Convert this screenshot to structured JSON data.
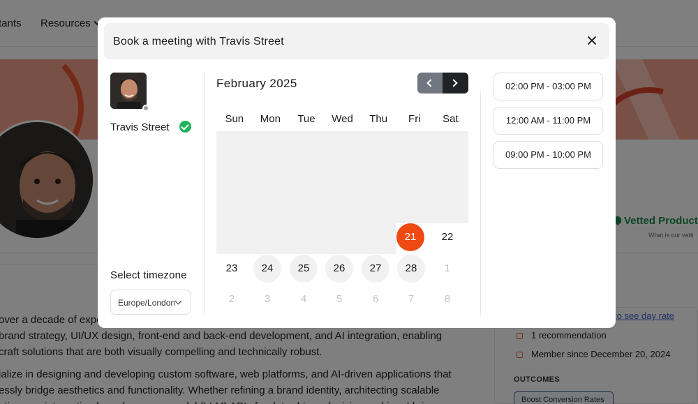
{
  "background": {
    "nav": {
      "consultants": "tants",
      "resources": "Resources"
    },
    "vetted_label": "Vetted Product",
    "vetting_note": "What is our vetti",
    "paragraph1": [
      "over a decade of expe",
      " brand strategy, UI/UX design, front-end and back-end development, and AI integration, enabling",
      " craft solutions that are both visually compelling and technically robust."
    ],
    "paragraph2": [
      "ialize in designing and developing custom software, web platforms, and AI-driven applications that",
      "essly bridge aesthetics and functionality. Whether refining a brand identity, architecting scalable",
      "utions, or integrating large language model (LLM) APIs for data-driven decision-making, I bring a"
    ],
    "day_rate_link": "to see day rate",
    "recommendation": "1 recommendation",
    "member_since": "Member since December 20, 2024",
    "outcomes_heading": "OUTCOMES",
    "outcome_tag": "Boost Conversion Rates"
  },
  "modal": {
    "title": "Book a meeting with Travis Street",
    "consultant_name": "Travis Street",
    "timezone_label": "Select timezone",
    "timezone_value": "Europe/London",
    "calendar": {
      "month": "February 2025",
      "weekdays": [
        "Sun",
        "Mon",
        "Tue",
        "Wed",
        "Thu",
        "Fri",
        "Sat"
      ],
      "days": {
        "d21": "21",
        "d22": "22",
        "d23": "23",
        "d24": "24",
        "d25": "25",
        "d26": "26",
        "d27": "27",
        "d28": "28",
        "n1": "1",
        "n2": "2",
        "n3": "3",
        "n4": "4",
        "n5": "5",
        "n6": "6",
        "n7": "7",
        "n8": "8"
      }
    },
    "time_slots": [
      "02:00 PM - 03:00 PM",
      "12:00 AM - 11:00 PM",
      "09:00 PM - 10:00 PM"
    ],
    "colors": {
      "selected": "#ef4a12",
      "verified": "#21b35a",
      "next_button": "#212225",
      "prev_button": "#707781"
    }
  }
}
